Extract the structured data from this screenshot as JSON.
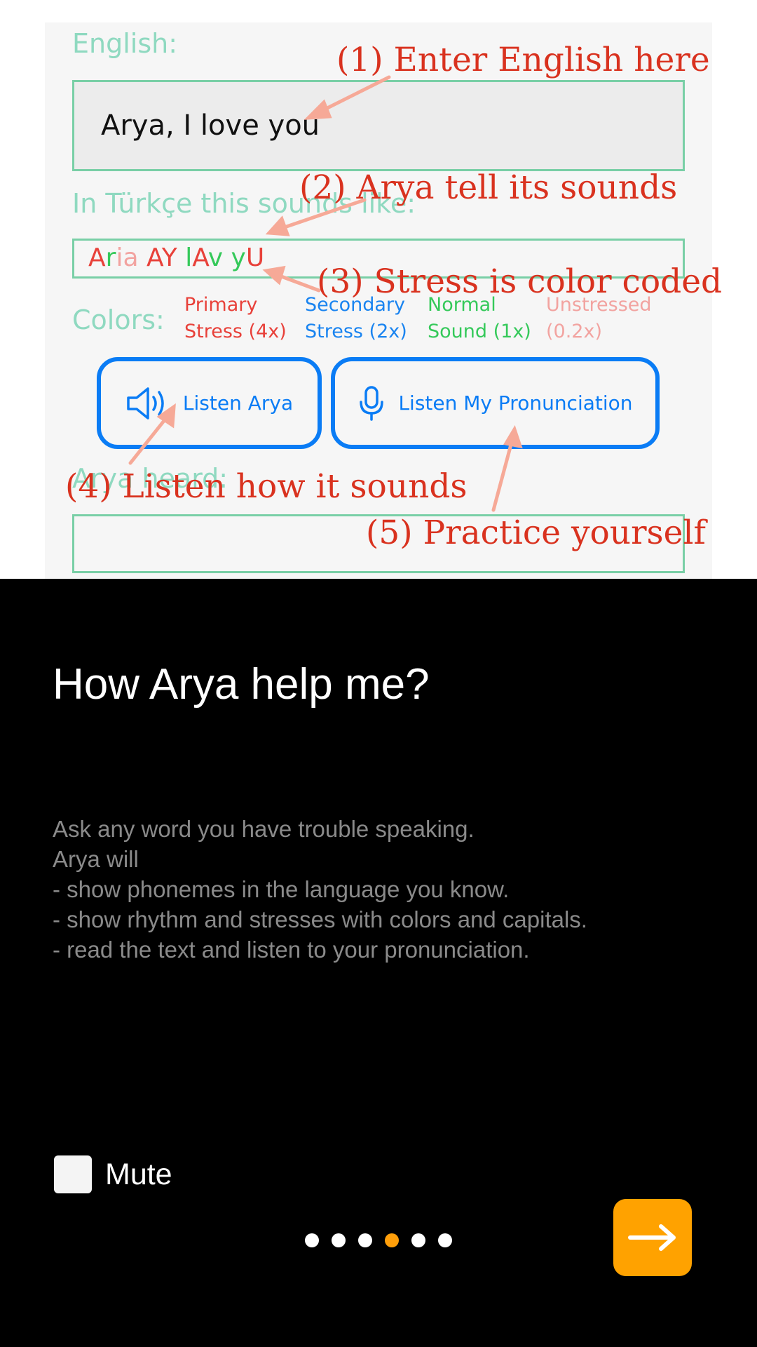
{
  "tutorial_image": {
    "english_label": "English:",
    "english_value": "Arya, I love you",
    "sounds_label": "In Türkçe this sounds like:",
    "sounds_parts": [
      {
        "text": "A",
        "color": "#e8413a"
      },
      {
        "text": "r",
        "color": "#35c95a"
      },
      {
        "text": "ia ",
        "color": "#f2a3a0"
      },
      {
        "text": "AY ",
        "color": "#e8413a"
      },
      {
        "text": "l",
        "color": "#35c95a"
      },
      {
        "text": "A",
        "color": "#e8413a"
      },
      {
        "text": "v ",
        "color": "#35c95a"
      },
      {
        "text": "y",
        "color": "#35c95a"
      },
      {
        "text": "U",
        "color": "#e8413a"
      }
    ],
    "colors_label": "Colors:",
    "legend": [
      {
        "line1": "Primary",
        "line2": "Stress (4x)",
        "color": "#e8413a"
      },
      {
        "line1": "Secondary",
        "line2": "Stress (2x)",
        "color": "#1a84f0"
      },
      {
        "line1": "Normal",
        "line2": "Sound (1x)",
        "color": "#35c95a"
      },
      {
        "line1": "Unstressed",
        "line2": "(0.2x)",
        "color": "#f2a3a0"
      }
    ],
    "listen_arya_label": "Listen Arya",
    "listen_my_label": "Listen My Pronunciation",
    "heard_label": "Arya heard:",
    "annotations": {
      "a1": "(1) Enter English here",
      "a2": "(2) Arya tell its sounds",
      "a3": "(3) Stress is color coded",
      "a4": "(4) Listen how it sounds",
      "a5": "(5) Practice yourself"
    },
    "icons": {
      "speaker": "speaker-icon",
      "mic": "microphone-icon"
    }
  },
  "title": "How Arya help me?",
  "description": "Ask any word you have trouble speaking.\nArya will\n- show phonemes in the language you know.\n- show rhythm and stresses with colors and capitals.\n- read the text and listen to your pronunciation.",
  "mute": {
    "label": "Mute",
    "checked": false
  },
  "pager": {
    "total": 6,
    "current": 4
  },
  "next_button": {
    "icon": "arrow-right-icon",
    "color": "#ffa200"
  }
}
